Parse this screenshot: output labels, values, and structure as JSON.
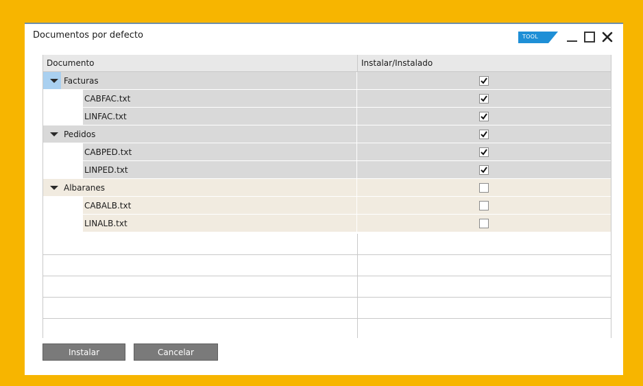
{
  "window": {
    "title": "Documentos por defecto",
    "tool_badge": "TOOL"
  },
  "grid": {
    "columns": [
      "Documento",
      "Instalar/Instalado"
    ],
    "rows": [
      {
        "label": "Facturas",
        "level": 0,
        "expanded": true,
        "checked": true,
        "group": "gray"
      },
      {
        "label": "CABFAC.txt",
        "level": 1,
        "checked": true,
        "group": "gray"
      },
      {
        "label": "LINFAC.txt",
        "level": 1,
        "checked": true,
        "group": "gray"
      },
      {
        "label": "Pedidos",
        "level": 0,
        "expanded": true,
        "checked": true,
        "group": "gray"
      },
      {
        "label": "CABPED.txt",
        "level": 1,
        "checked": true,
        "group": "gray"
      },
      {
        "label": "LINPED.txt",
        "level": 1,
        "checked": true,
        "group": "gray"
      },
      {
        "label": "Albaranes",
        "level": 0,
        "expanded": true,
        "checked": false,
        "group": "beige"
      },
      {
        "label": "CABALB.txt",
        "level": 1,
        "checked": false,
        "group": "beige"
      },
      {
        "label": "LINALB.txt",
        "level": 1,
        "checked": false,
        "group": "beige"
      }
    ]
  },
  "buttons": {
    "install": "Instalar",
    "cancel": "Cancelar"
  },
  "colors": {
    "background": "#f7b500",
    "row_gray": "#d9d9d9",
    "row_beige": "#f1ebe0",
    "selection": "#a9d0f0",
    "tool_badge": "#1e8fd6"
  }
}
